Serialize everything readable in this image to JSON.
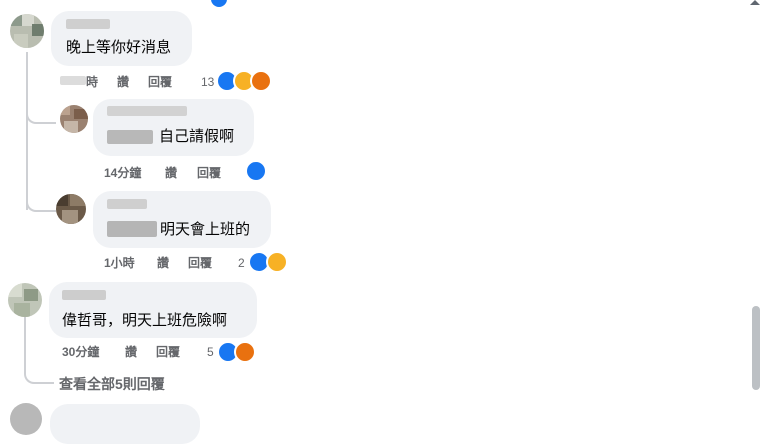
{
  "comments": [
    {
      "text": "晚上等你好消息",
      "meta": {
        "time": "時",
        "like": "讚",
        "reply": "回覆"
      },
      "reaction_count": "13",
      "reactions": [
        "like-icon",
        "haha-icon",
        "angry-icon"
      ]
    },
    {
      "text": "自己請假啊",
      "meta": {
        "time": "14分鐘",
        "like": "讚",
        "reply": "回覆"
      },
      "reaction_count": "",
      "reactions": [
        "like-icon"
      ]
    },
    {
      "text": "明天會上班的",
      "meta": {
        "time": "1小時",
        "like": "讚",
        "reply": "回覆"
      },
      "reaction_count": "2",
      "reactions": [
        "like-icon",
        "haha-icon"
      ]
    },
    {
      "text": "偉哲哥，明天上班危險啊",
      "meta": {
        "time": "30分鐘",
        "like": "讚",
        "reply": "回覆"
      },
      "reaction_count": "5",
      "reactions": [
        "like-icon",
        "angry-icon"
      ]
    }
  ],
  "view_more_replies": "查看全部5則回覆",
  "colors": {
    "like": "#1877f2",
    "haha": "#f7b125",
    "angry": "#e9710f",
    "meta_text": "#65676b",
    "bubble": "#f0f2f5"
  }
}
